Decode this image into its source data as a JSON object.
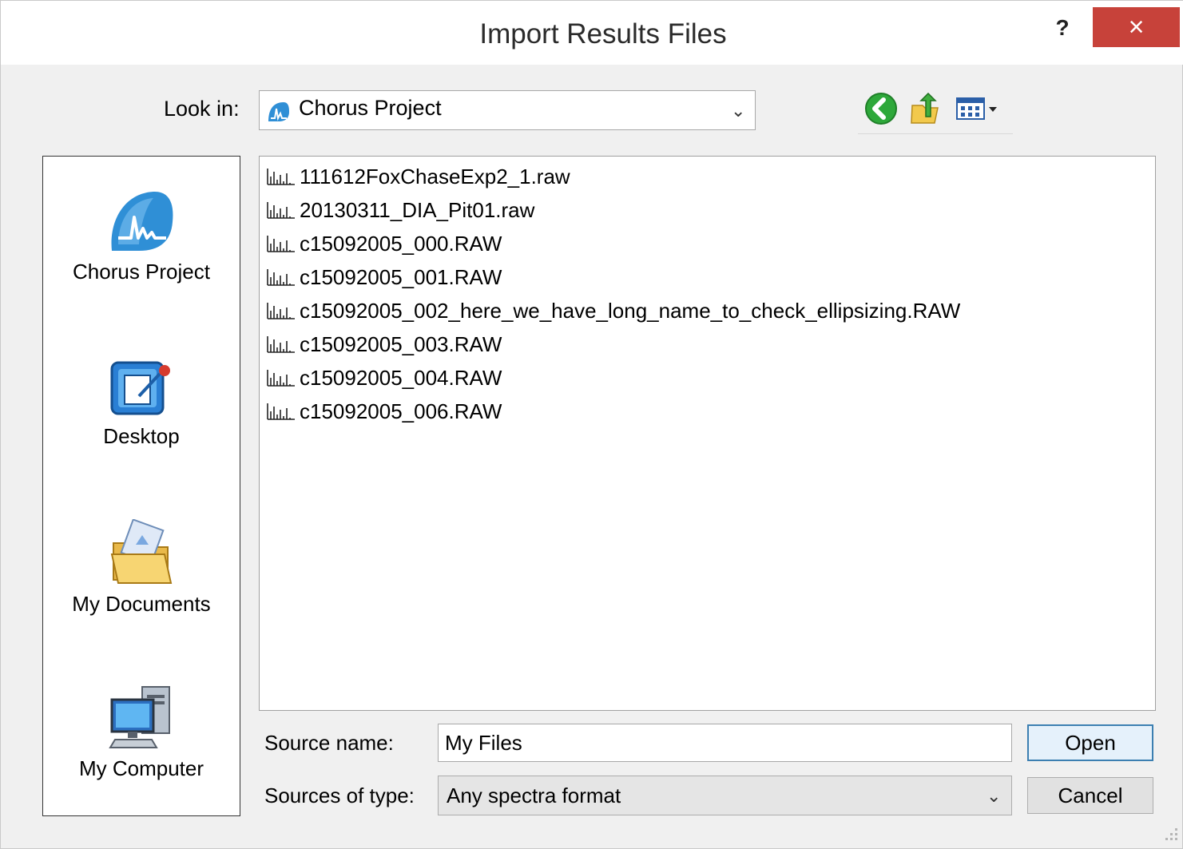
{
  "window": {
    "title": "Import Results Files",
    "help_label": "?",
    "close_label": "×"
  },
  "lookin": {
    "label": "Look in:",
    "value": "Chorus Project"
  },
  "toolbar": {
    "icons": [
      "back-icon",
      "up-folder-icon",
      "view-menu-icon"
    ],
    "accent": "#2ea83a"
  },
  "places": [
    {
      "label": "Chorus Project",
      "icon": "chorus-project-icon"
    },
    {
      "label": "Desktop",
      "icon": "desktop-icon"
    },
    {
      "label": "My Documents",
      "icon": "my-documents-icon"
    },
    {
      "label": "My Computer",
      "icon": "my-computer-icon"
    }
  ],
  "files": [
    "111612FoxChaseExp2_1.raw",
    "20130311_DIA_Pit01.raw",
    "c15092005_000.RAW",
    "c15092005_001.RAW",
    "c15092005_002_here_we_have_long_name_to_check_ellipsizing.RAW",
    "c15092005_003.RAW",
    "c15092005_004.RAW",
    "c15092005_006.RAW"
  ],
  "source_name": {
    "label": "Source name:",
    "value": "My Files"
  },
  "source_type": {
    "label": "Sources of type:",
    "value": "Any spectra format"
  },
  "buttons": {
    "open": "Open",
    "cancel": "Cancel"
  },
  "colors": {
    "close_bg": "#c7423a",
    "dialog_bg": "#f0f0f0",
    "default_button_border": "#3c7fb1"
  }
}
